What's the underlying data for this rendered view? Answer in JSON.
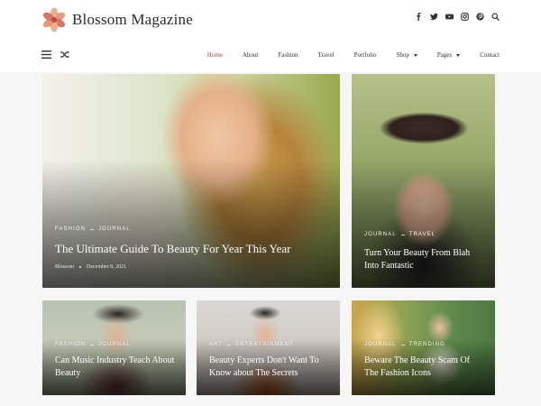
{
  "brand": {
    "name": "Blossom Magazine",
    "logo_icon": "flower-logo-icon",
    "accent": "#c1403e"
  },
  "social": [
    {
      "name": "facebook-icon"
    },
    {
      "name": "twitter-icon"
    },
    {
      "name": "youtube-icon"
    },
    {
      "name": "instagram-icon"
    },
    {
      "name": "pinterest-icon"
    },
    {
      "name": "search-icon"
    }
  ],
  "nav": {
    "menu_icon": "hamburger-menu-icon",
    "shuffle_icon": "shuffle-icon",
    "items": [
      {
        "label": "Home",
        "active": true
      },
      {
        "label": "About"
      },
      {
        "label": "Fashion"
      },
      {
        "label": "Travel"
      },
      {
        "label": "Portfolio"
      },
      {
        "label": "Shop",
        "dropdown": true
      },
      {
        "label": "Pages",
        "dropdown": true
      },
      {
        "label": "Contact"
      }
    ]
  },
  "featured": {
    "categories": [
      "Fashion",
      "Journal"
    ],
    "title": "The Ultimate Guide To Beauty For Year This Year",
    "author": "Blossom",
    "date": "December 8, 2021"
  },
  "side": {
    "categories": [
      "Journal",
      "Travel"
    ],
    "title": "Turn Your Beauty From Blah Into Fantastic"
  },
  "posts": [
    {
      "categories": [
        "Fashion",
        "Journal"
      ],
      "title": "Can Music Industry Teach About Beauty"
    },
    {
      "categories": [
        "Art",
        "Entertainment"
      ],
      "title": "Beauty Experts Don't Want To Know about The Secrets"
    },
    {
      "categories": [
        "Journal",
        "Trending"
      ],
      "title": "Beware The Beauty Scam Of The Fashion Icons"
    }
  ]
}
